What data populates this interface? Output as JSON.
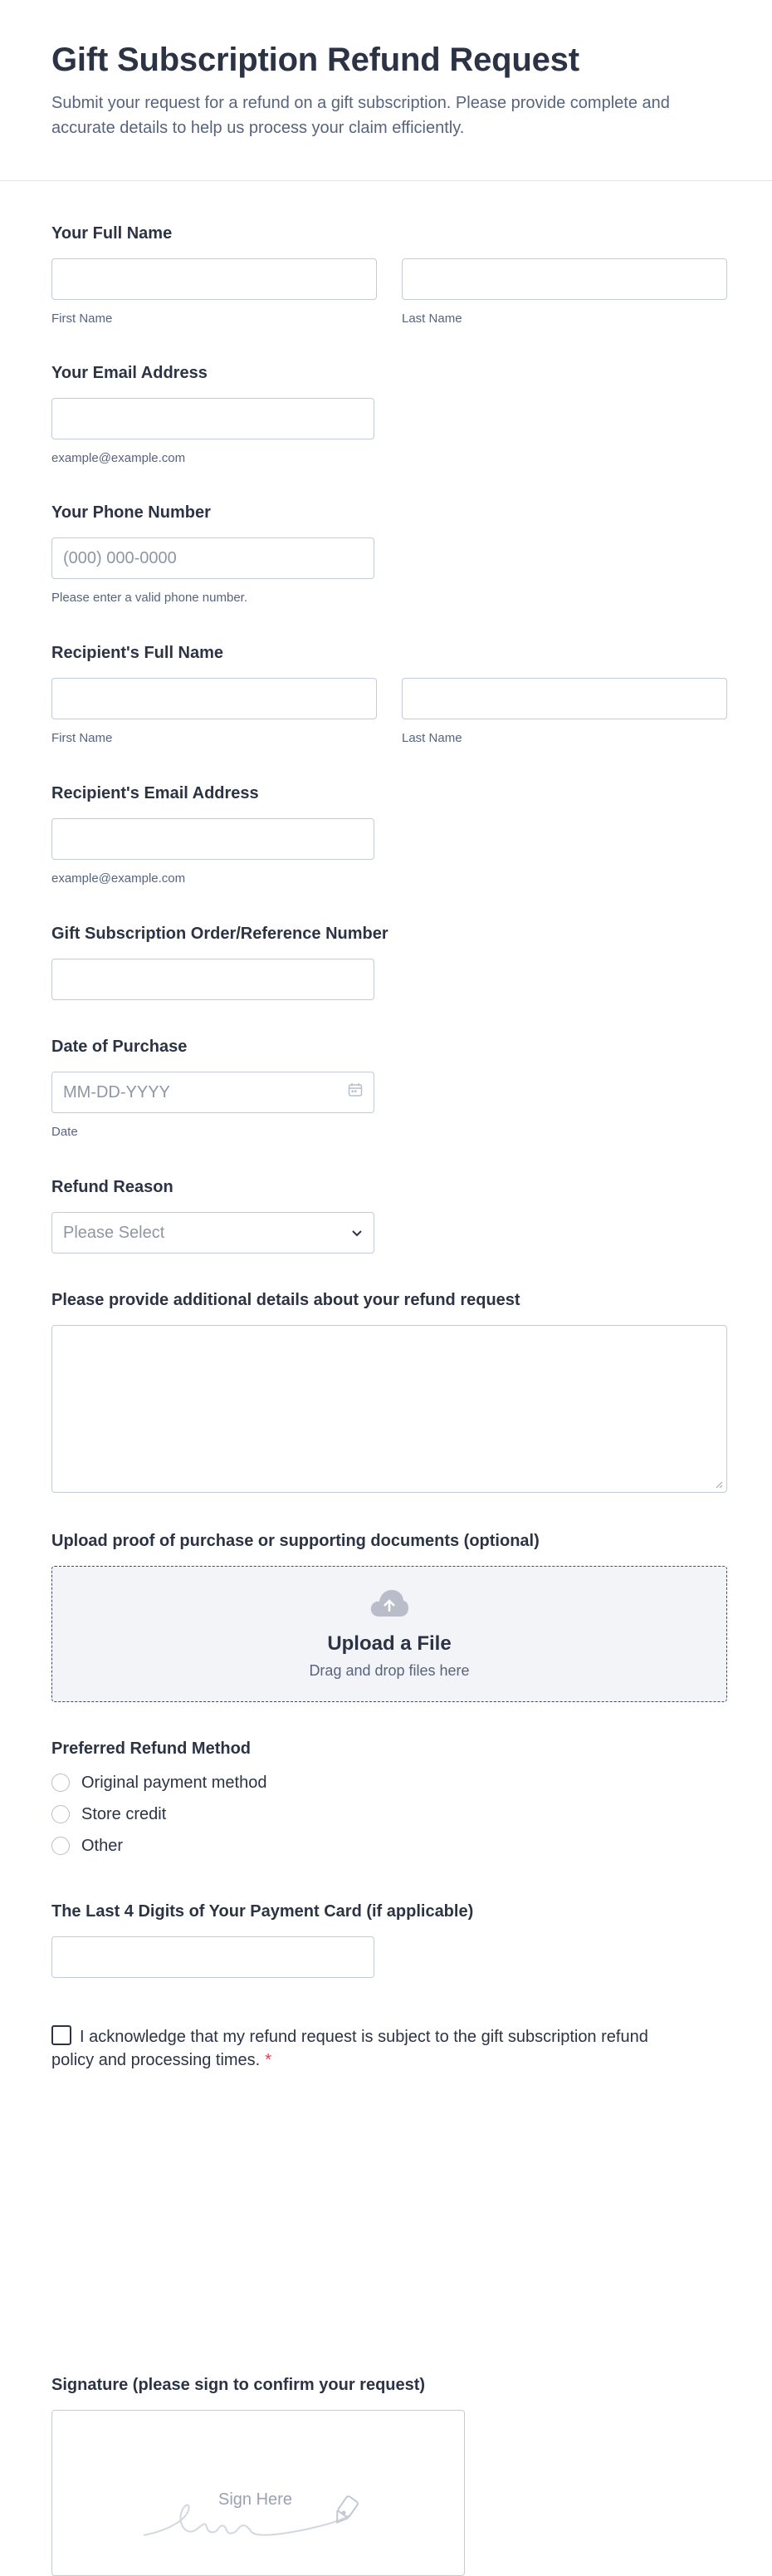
{
  "header": {
    "title": "Gift Subscription Refund Request",
    "subtitle": "Submit your request for a refund on a gift subscription. Please provide complete and accurate details to help us process your claim efficiently."
  },
  "full_name": {
    "label": "Your Full Name",
    "first_sub": "First Name",
    "last_sub": "Last Name"
  },
  "email": {
    "label": "Your Email Address",
    "sub": "example@example.com"
  },
  "phone": {
    "label": "Your Phone Number",
    "placeholder": "(000) 000-0000",
    "sub": "Please enter a valid phone number."
  },
  "recipient_name": {
    "label": "Recipient's Full Name",
    "first_sub": "First Name",
    "last_sub": "Last Name"
  },
  "recipient_email": {
    "label": "Recipient's Email Address",
    "sub": "example@example.com"
  },
  "order_number": {
    "label": "Gift Subscription Order/Reference Number"
  },
  "purchase_date": {
    "label": "Date of Purchase",
    "placeholder": "MM-DD-YYYY",
    "sub": "Date"
  },
  "refund_reason": {
    "label": "Refund Reason",
    "selected": "Please Select"
  },
  "details": {
    "label": "Please provide additional details about your refund request"
  },
  "upload": {
    "label": "Upload proof of purchase or supporting documents (optional)",
    "title": "Upload a File",
    "sub": "Drag and drop files here"
  },
  "refund_method": {
    "label": "Preferred Refund Method",
    "options": [
      "Original payment method",
      "Store credit",
      "Other"
    ]
  },
  "card_digits": {
    "label": "The Last 4 Digits of Your Payment Card (if applicable)"
  },
  "acknowledge": {
    "text": "I acknowledge that my refund request is subject to the gift subscription refund policy and processing times.",
    "required_mark": "*"
  },
  "signature": {
    "label": "Signature (please sign to confirm your request)",
    "placeholder": "Sign Here"
  }
}
